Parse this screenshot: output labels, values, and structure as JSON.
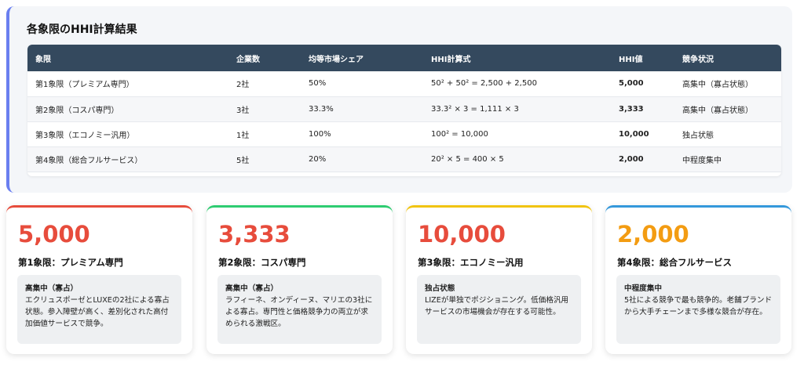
{
  "panel": {
    "title": "各象限のHHI計算結果",
    "columns": [
      "象限",
      "企業数",
      "均等市場シェア",
      "HHI計算式",
      "HHI値",
      "競争状況"
    ],
    "rows": [
      [
        "第1象限（プレミアム専門）",
        "2社",
        "50%",
        "50² + 50² = 2,500 + 2,500",
        "5,000",
        "高集中（寡占状態）"
      ],
      [
        "第2象限（コスパ専門）",
        "3社",
        "33.3%",
        "33.3² × 3 = 1,111 × 3",
        "3,333",
        "高集中（寡占状態）"
      ],
      [
        "第3象限（エコノミー汎用）",
        "1社",
        "100%",
        "100² = 10,000",
        "10,000",
        "独占状態"
      ],
      [
        "第4象限（総合フルサービス）",
        "5社",
        "20%",
        "20² × 5 = 400 × 5",
        "2,000",
        "中程度集中"
      ]
    ]
  },
  "cards": [
    {
      "value": "5,000",
      "name": "第1象限：プレミアム専門",
      "status": "高集中（寡占）",
      "desc": "エクリュスポーゼとLUXEの2社による寡占状態。参入障壁が高く、差別化された高付加価値サービスで競争。",
      "value_color": "#e74c3c",
      "accent": "#e74c3c"
    },
    {
      "value": "3,333",
      "name": "第2象限：コスパ専門",
      "status": "高集中（寡占）",
      "desc": "ラフィーネ、オンディーヌ、マリエの3社による寡占。専門性と価格競争力の両立が求められる激戦区。",
      "value_color": "#e74c3c",
      "accent": "#2ecc71"
    },
    {
      "value": "10,000",
      "name": "第3象限：エコノミー汎用",
      "status": "独占状態",
      "desc": "LIZEが単独でポジショニング。低価格汎用サービスの市場機会が存在する可能性。",
      "value_color": "#e74c3c",
      "accent": "#f1c40f"
    },
    {
      "value": "2,000",
      "name": "第4象限：総合フルサービス",
      "status": "中程度集中",
      "desc": "5社による競争で最も競争的。老舗ブランドから大手チェーンまで多様な競合が存在。",
      "value_color": "#f39c12",
      "accent": "#3498db"
    }
  ]
}
